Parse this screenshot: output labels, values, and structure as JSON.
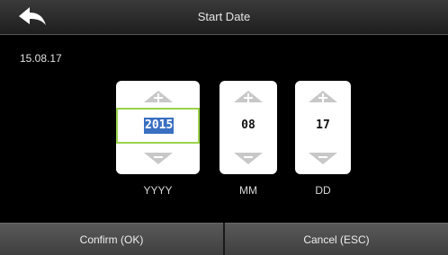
{
  "header": {
    "title": "Start Date",
    "back_icon": "back-arrow-icon"
  },
  "preview": {
    "date": "15.08.17"
  },
  "fields": {
    "year": {
      "value": "2015",
      "unit": "YYYY"
    },
    "month": {
      "value": "08",
      "unit": "MM"
    },
    "day": {
      "value": "17",
      "unit": "DD"
    }
  },
  "footer": {
    "confirm_label": "Confirm (OK)",
    "cancel_label": "Cancel (ESC)"
  },
  "colors": {
    "focus_border": "#9ad24b",
    "selection": "#3a6fc2"
  }
}
